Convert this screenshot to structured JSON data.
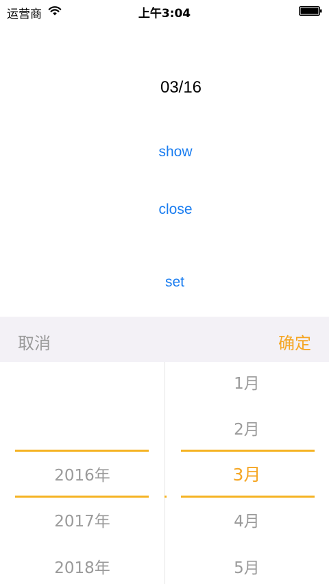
{
  "status_bar": {
    "carrier": "运营商",
    "time": "上午3:04"
  },
  "main": {
    "date_display": "03/16",
    "show_label": "show",
    "close_label": "close",
    "set_label": "set"
  },
  "picker": {
    "cancel_label": "取消",
    "confirm_label": "确定",
    "years": [
      "2016年",
      "2017年",
      "2018年"
    ],
    "months": [
      "1月",
      "2月",
      "3月",
      "4月",
      "5月"
    ],
    "selected_year": "2016年",
    "selected_month": "3月"
  },
  "colors": {
    "link": "#1a7df0",
    "accent": "#f5a623",
    "muted": "#9a9a9a",
    "toolbar_bg": "#f3f1f6"
  },
  "icons": [
    "wifi-icon",
    "battery-icon"
  ]
}
